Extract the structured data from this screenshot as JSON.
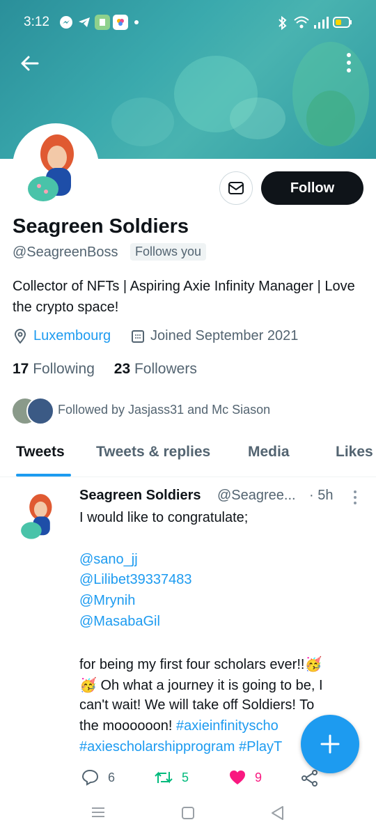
{
  "status_bar": {
    "time": "3:12"
  },
  "profile": {
    "name": "Seagreen Soldiers",
    "handle": "@SeagreenBoss",
    "follows_you": "Follows you",
    "follow_label": "Follow",
    "bio": "Collector of NFTs | Aspiring Axie Infinity Manager | Love the crypto space!",
    "location": "Luxembourg",
    "joined": "Joined September 2021",
    "following_count": "17",
    "following_label": "Following",
    "followers_count": "23",
    "followers_label": "Followers",
    "followed_by": "Followed by Jasjass31 and Mc Siason"
  },
  "tabs": [
    {
      "label": "Tweets",
      "active": true
    },
    {
      "label": "Tweets & replies"
    },
    {
      "label": "Media"
    },
    {
      "label": "Likes"
    }
  ],
  "tweet": {
    "author_name": "Seagreen Soldiers",
    "author_handle": "@Seagree...",
    "time": "· 5h",
    "line1": "I would like to congratulate;",
    "mentions": [
      "@sano_jj",
      "@Lilibet39337483",
      "@Mrynih",
      "@MasabaGil"
    ],
    "body_line1": "for being my first four scholars ever!!🥳",
    "body_line2": "🥳 Oh what a journey it is going to be, I",
    "body_line3": "can't wait! We will take off Soldiers! To",
    "body_line4_a": "the moooooon! ",
    "body_line4_b": "#axieinfinitysch",
    "body_line4_c": "o",
    "body_line5_a": "#axiescholarshipprogram",
    "body_line5_b": " #PlayT",
    "replies": "6",
    "retweets": "5",
    "likes": "9"
  },
  "colors": {
    "accent": "#1d9bf0",
    "retweet": "#00ba7c",
    "like": "#f91880"
  }
}
